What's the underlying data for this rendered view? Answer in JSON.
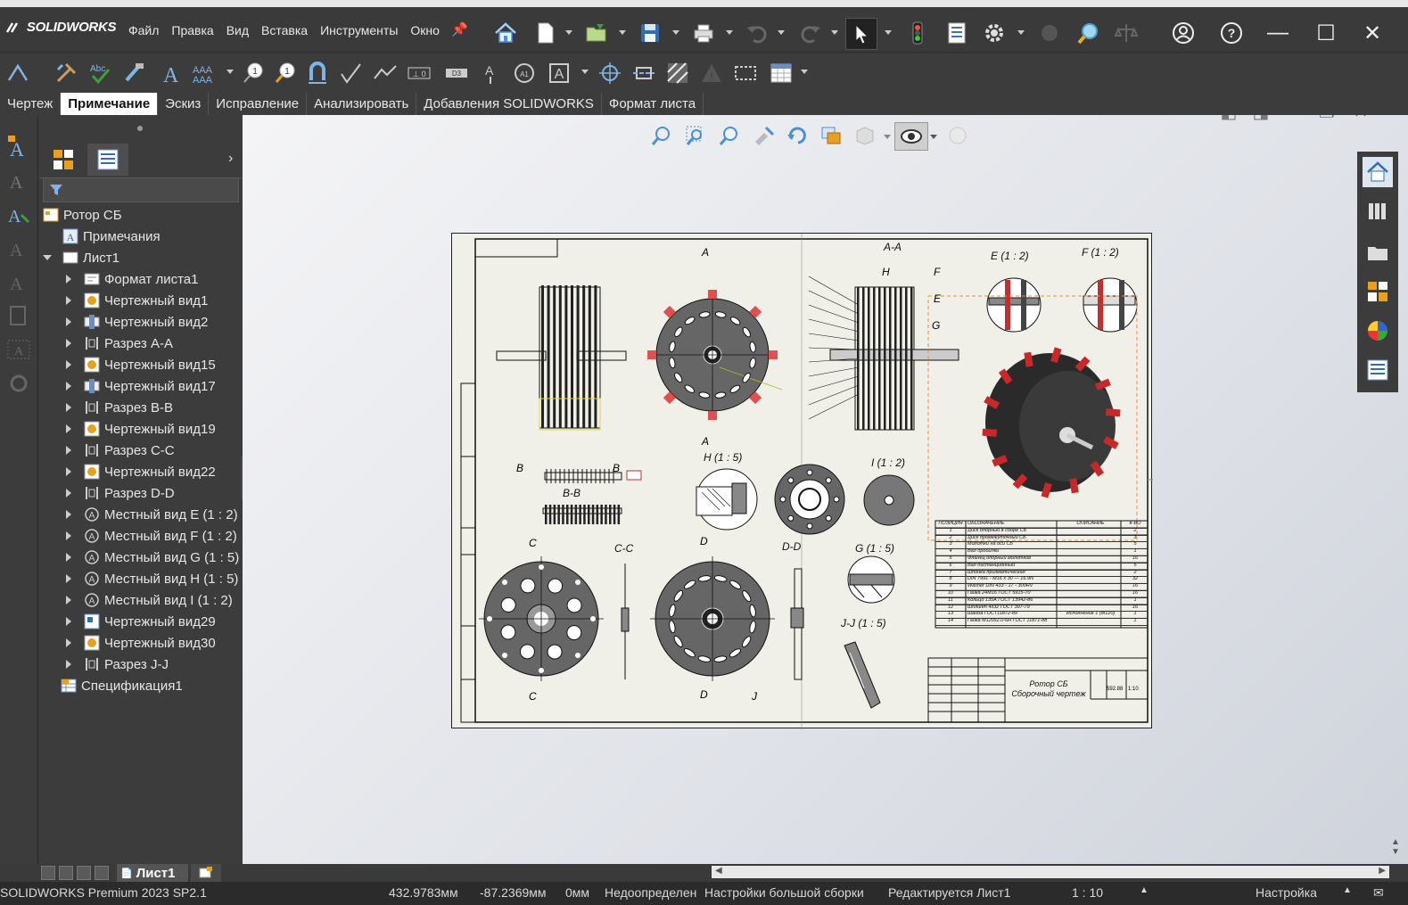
{
  "app": {
    "logo": "SOLIDWORKS",
    "menu": [
      "Файл",
      "Правка",
      "Вид",
      "Вставка",
      "Инструменты",
      "Окно"
    ]
  },
  "tabs": [
    "Чертеж",
    "Примечание",
    "Эскиз",
    "Исправление",
    "Анализировать",
    "Добавления SOLIDWORKS",
    "Формат листа"
  ],
  "active_tab": "Примечание",
  "tree": {
    "root": "Ротор СБ",
    "notes": "Примечания",
    "sheet": "Лист1",
    "children": [
      "Формат листа1",
      "Чертежный вид1",
      "Чертежный вид2",
      "Разрез A-A",
      "Чертежный вид15",
      "Чертежный вид17",
      "Разрез B-B",
      "Чертежный вид19",
      "Разрез C-C",
      "Чертежный вид22",
      "Разрез D-D",
      "Местный вид E (1 : 2)",
      "Местный вид F (1 : 2)",
      "Местный вид G (1 : 5)",
      "Местный вид H (1 : 5)",
      "Местный вид I (1 : 2)",
      "Чертежный вид29",
      "Чертежный вид30",
      "Разрез J-J"
    ],
    "child_types": [
      "format",
      "view",
      "view2",
      "section",
      "view",
      "view2",
      "section",
      "view",
      "section",
      "view",
      "section",
      "detail",
      "detail",
      "detail",
      "detail",
      "detail",
      "view3",
      "view",
      "section"
    ],
    "spec": "Спецификация1"
  },
  "drawing": {
    "labels": {
      "aa": "A-A",
      "e": "E (1 : 2)",
      "f": "F (1 : 2)",
      "h": "H (1 : 5)",
      "i": "I (1 : 2)",
      "bb": "B-B",
      "cc": "C-C",
      "dd": "D-D",
      "g": "G (1 : 5)",
      "jj": "J-J (1 : 5)",
      "a1": "A",
      "a2": "A",
      "b1": "B",
      "b2": "B",
      "c1": "C",
      "c2": "C",
      "d1": "D",
      "d2": "D",
      "j": "J",
      "h_call": "H",
      "f_call": "F",
      "e_call": "E",
      "g_call": "G"
    },
    "title_block": {
      "name": "Ротор СБ",
      "subtitle": "Сборочный чертеж",
      "mass": "592.88",
      "scale": "1:10"
    },
    "bom_header": [
      "ПОЗИЦИЯ",
      "ОБОЗНАЧЕНИЕ",
      "ОПИСАНИЕ",
      "К-ВО"
    ],
    "bom_rows": [
      [
        "1",
        "Диск опорный в сборе СБ",
        "",
        "2"
      ],
      [
        "2",
        "Диск промежуточный СБ",
        "",
        "3"
      ],
      [
        "3",
        "Молотки на оси СБ",
        "",
        "5"
      ],
      [
        "4",
        "Вал дробилки",
        "",
        "1"
      ],
      [
        "5",
        "Фланец опорный молотков",
        "",
        "16"
      ],
      [
        "6",
        "Вал дистанционный",
        "",
        "5"
      ],
      [
        "7",
        "Шпонка призматическая",
        "",
        "2"
      ],
      [
        "8",
        "DIN 7991 - M16 x 30 --- 16.9N",
        "",
        "32"
      ],
      [
        "9",
        "Washer DIN 433 - 17 - 300HV",
        "",
        "16"
      ],
      [
        "10",
        "Гайка 24М16 ГОСТ 5915-70",
        "",
        "16"
      ],
      [
        "11",
        "Кольцо 135А ГОСТ 13942-86",
        "",
        "1"
      ],
      [
        "12",
        "Шплинт 4х32 ГОСТ 397-79",
        "",
        "16"
      ],
      [
        "13",
        "Шайба ГОСТ11872-89",
        "Исполнение 1 (М120)",
        "1"
      ],
      [
        "14",
        "Гайка М120х2.0-6Н ГОСТ 11871-88",
        "",
        "1"
      ]
    ]
  },
  "sheet_tab": "Лист1",
  "status": {
    "product": "SOLIDWORKS Premium 2023 SP2.1",
    "x": "432.9783мм",
    "y": "-87.2369мм",
    "z": "0мм",
    "state": "Недоопределен",
    "large_asm": "Настройки большой сборки",
    "editing": "Редактируется Лист1",
    "scale": "1 : 10",
    "custom": "Настройка"
  },
  "colors": {
    "accent_red": "#cc2a2a",
    "sheet_bg": "#f0efe8",
    "toolbar_bg": "#3c3c3c"
  }
}
